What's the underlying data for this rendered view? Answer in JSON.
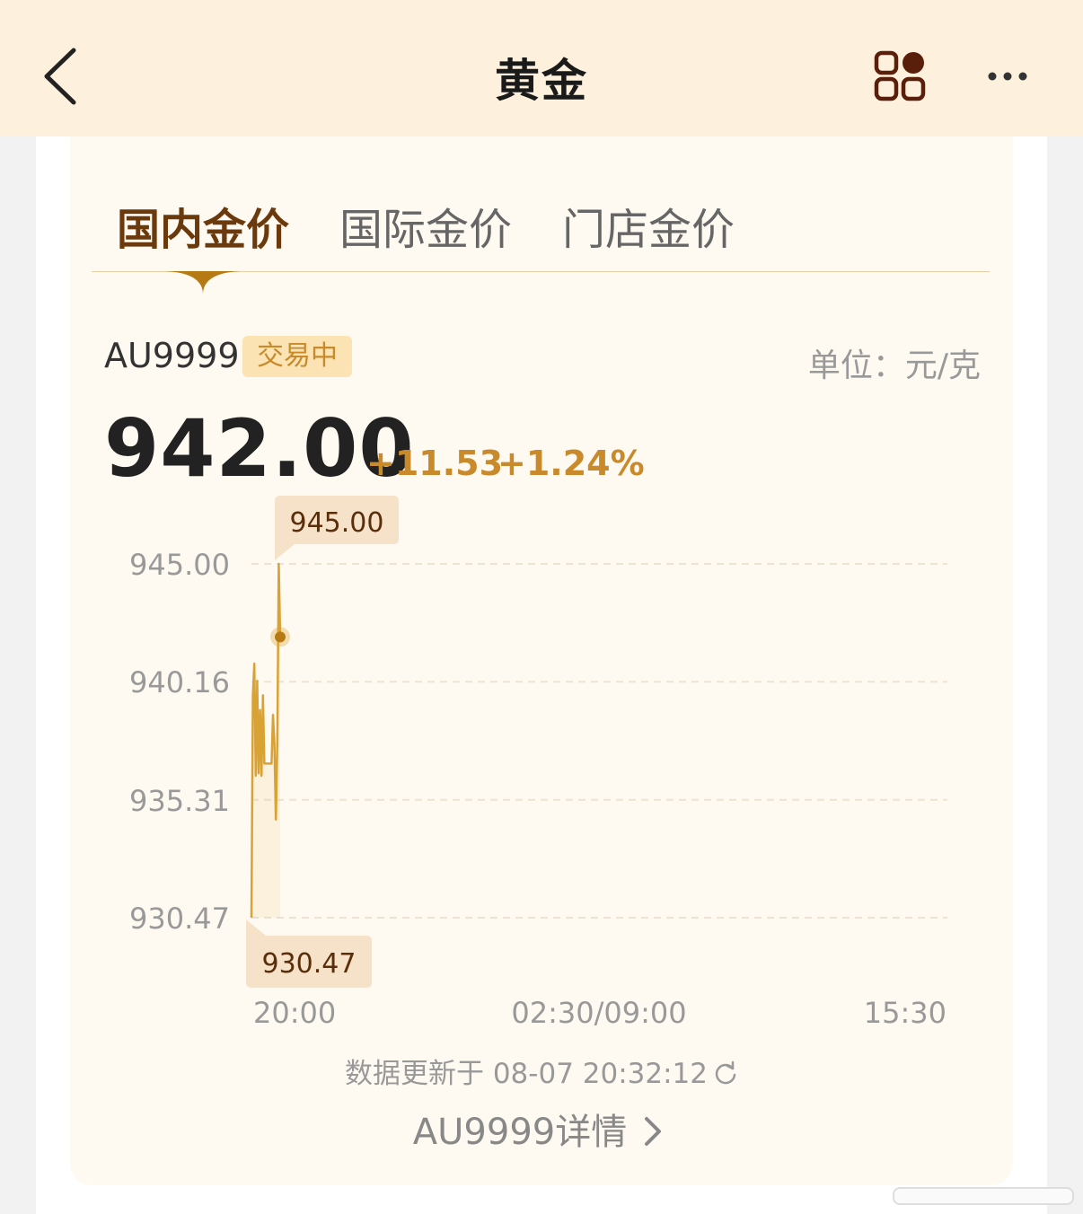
{
  "header": {
    "title": "黄金",
    "back_icon": "chevron-left-icon",
    "apps_icon": "apps-grid-icon",
    "more_icon": "more-dots-icon"
  },
  "tabs": [
    {
      "label": "国内金价",
      "active": true
    },
    {
      "label": "国际金价",
      "active": false
    },
    {
      "label": "门店金价",
      "active": false
    }
  ],
  "quote": {
    "code": "AU9999",
    "status": "交易中",
    "unit": "单位：元/克",
    "price": "942.00",
    "change": "+11.53",
    "change_pct": "+1.24%"
  },
  "colors": {
    "accent": "#c98a2b",
    "line": "#d9a235",
    "header_bg": "#fdf0dc",
    "tab_active": "#6b3a0c"
  },
  "chart_data": {
    "type": "line",
    "ylim": [
      930.47,
      945.0
    ],
    "yticks": [
      "945.00",
      "940.16",
      "935.31",
      "930.47"
    ],
    "xticks": [
      "20:00",
      "02:30/09:00",
      "15:30"
    ],
    "high_label": "945.00",
    "low_label": "930.47",
    "series": [
      {
        "x": [
          0,
          1,
          2,
          3,
          4,
          5,
          6,
          7,
          8,
          9,
          10,
          11,
          12,
          13,
          14,
          15,
          16,
          17,
          18,
          19,
          20
        ],
        "values": [
          930.47,
          939.6,
          940.9,
          936.3,
          940.2,
          936.4,
          939.0,
          936.3,
          939.6,
          936.8,
          936.8,
          936.8,
          936.8,
          936.8,
          936.8,
          938.8,
          937.6,
          934.5,
          937.6,
          945.0,
          942.0
        ]
      }
    ]
  },
  "footer": {
    "updated": "数据更新于 08-07 20:32:12",
    "detail_link": "AU9999详情",
    "refresh_icon": "refresh-icon",
    "detail_icon": "chevron-right-icon"
  }
}
